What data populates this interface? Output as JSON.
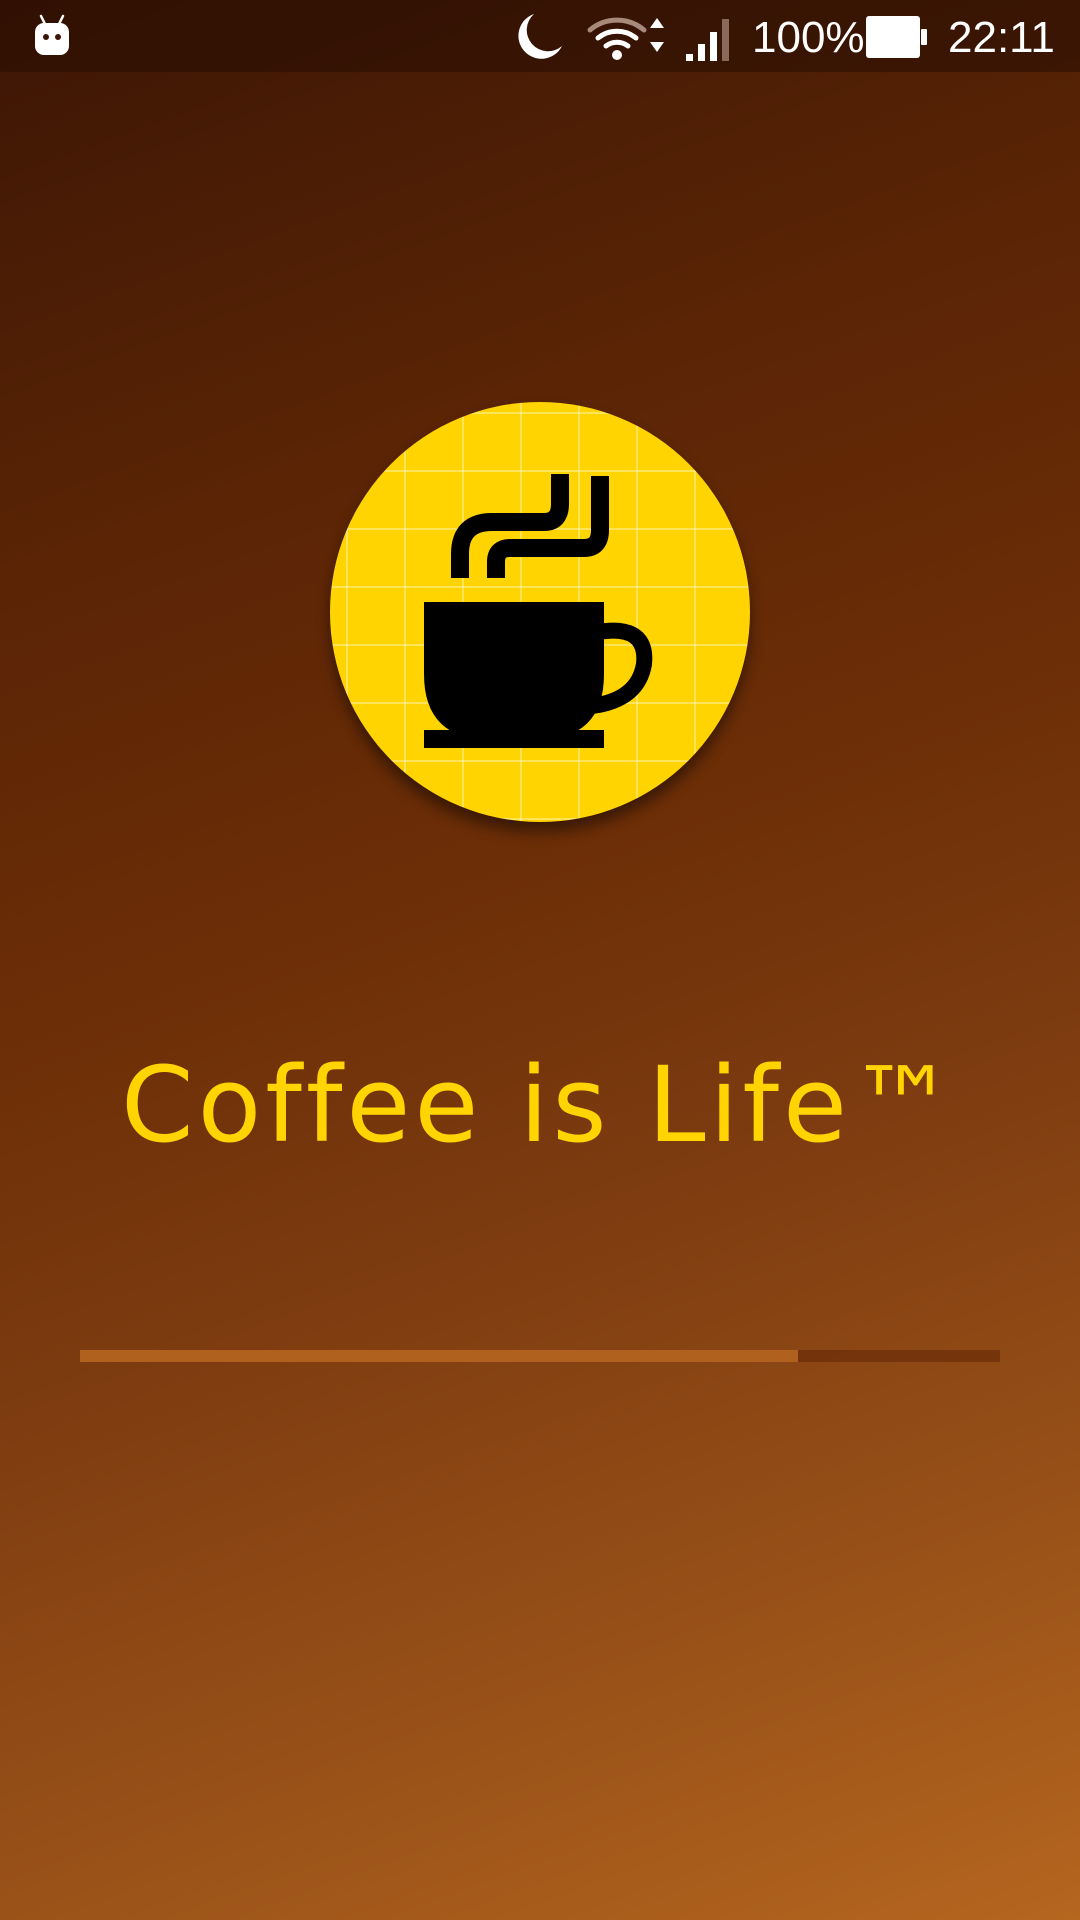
{
  "status_bar": {
    "battery_percent": "100%",
    "time": "22:11",
    "icons": [
      "android-notification-icon",
      "do-not-disturb-moon-icon",
      "wifi-icon",
      "data-arrows-icon",
      "cell-signal-icon",
      "battery-icon"
    ]
  },
  "splash": {
    "logo_icon": "coffee-cup-icon",
    "tagline": "Coffee is Life™",
    "progress_fraction": 0.78
  },
  "colors": {
    "accent_yellow": "#ffd400",
    "progress_fill": "#b0611e",
    "background_dark": "#3c1605",
    "background_light": "#b5661f"
  }
}
